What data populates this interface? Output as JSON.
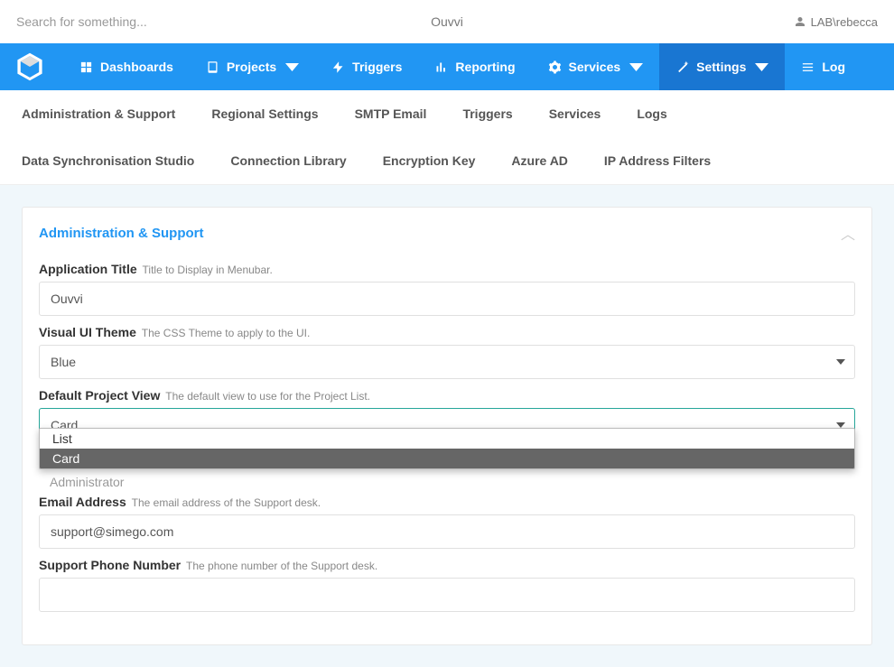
{
  "topbar": {
    "search_placeholder": "Search for something...",
    "app_title": "Ouvvi",
    "user_label": "LAB\\rebecca"
  },
  "nav": {
    "dashboards": "Dashboards",
    "projects": "Projects",
    "triggers": "Triggers",
    "reporting": "Reporting",
    "services": "Services",
    "settings": "Settings",
    "log": "Log"
  },
  "subnav": {
    "items": [
      "Administration & Support",
      "Regional Settings",
      "SMTP Email",
      "Triggers",
      "Services",
      "Logs",
      "Data Synchronisation Studio",
      "Connection Library",
      "Encryption Key",
      "Azure AD",
      "IP Address Filters"
    ]
  },
  "panel": {
    "title": "Administration & Support"
  },
  "form": {
    "app_title": {
      "label": "Application Title",
      "hint": "Title to Display in Menubar.",
      "value": "Ouvvi"
    },
    "theme": {
      "label": "Visual UI Theme",
      "hint": "The CSS Theme to apply to the UI.",
      "value": "Blue"
    },
    "project_view": {
      "label": "Default Project View",
      "hint": "The default view to use for the Project List.",
      "value": "Card",
      "options": [
        "List",
        "Card"
      ]
    },
    "obscured_value": "Administrator",
    "email": {
      "label": "Email Address",
      "hint": "The email address of the Support desk.",
      "value": "support@simego.com"
    },
    "phone": {
      "label": "Support Phone Number",
      "hint": "The phone number of the Support desk.",
      "value": ""
    }
  }
}
